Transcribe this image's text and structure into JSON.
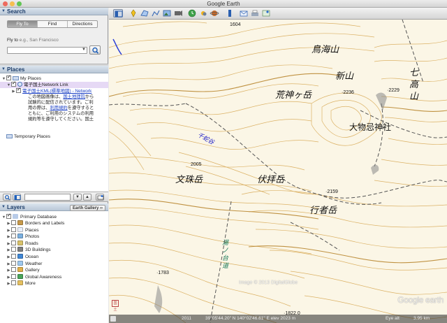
{
  "window": {
    "title": "Google Earth"
  },
  "search": {
    "header": "Search",
    "tabs": [
      {
        "label": "Fly To",
        "active": true
      },
      {
        "label": "Find Businesses",
        "active": false
      },
      {
        "label": "Directions",
        "active": false
      }
    ],
    "fly_to_label": "Fly to",
    "fly_to_example": "e.g., San Francisco",
    "input_value": ""
  },
  "places": {
    "header": "Places",
    "my_places": "My Places",
    "network_link": "電子国土Network Link",
    "kml_link_text": "電子国土KML(標準地図) - Network",
    "description": {
      "line1": "この地図画像は、",
      "link_gsi": "国土地理院",
      "line1b": "から",
      "line2": "試験的に配信されています。ご利",
      "line3": "用の際は、",
      "link_terms": "利用規約",
      "line3b": "を遵守すると",
      "line4": "ともに、ご利用のシステムの利用",
      "line5": "規約等を遵守してください。国土"
    },
    "temporary_places": "Temporary Places"
  },
  "layers": {
    "header": "Layers",
    "earth_gallery": "Earth Gallery ››",
    "primary_database": "Primary Database",
    "items": [
      {
        "label": "Borders and Labels",
        "icon": "borders-icon",
        "color": "#c79a4a"
      },
      {
        "label": "Places",
        "icon": "places-icon",
        "color": "#e8eef8"
      },
      {
        "label": "Photos",
        "icon": "photos-icon",
        "color": "#7bb0e0"
      },
      {
        "label": "Roads",
        "icon": "roads-icon",
        "color": "#d9c26a"
      },
      {
        "label": "3D Buildings",
        "icon": "buildings-icon",
        "color": "#7f7f7f"
      },
      {
        "label": "Ocean",
        "icon": "ocean-icon",
        "color": "#3f87d6"
      },
      {
        "label": "Weather",
        "icon": "weather-icon",
        "color": "#9ec9ef"
      },
      {
        "label": "Gallery",
        "icon": "gallery-icon",
        "color": "#e2b04a"
      },
      {
        "label": "Global Awareness",
        "icon": "global-awareness-icon",
        "color": "#4aa55a"
      },
      {
        "label": "More",
        "icon": "more-icon",
        "color": "#e5c060"
      }
    ]
  },
  "map": {
    "labels": {
      "chokai": "鳥海山",
      "shinzan": "新山",
      "shichikozan": "七高山",
      "arakamigatake": "荒神ヶ岳",
      "omonoimi": "大物忌神社",
      "senjadani": "千蛇谷",
      "monjudake": "文珠岳",
      "fukugamidake": "伏拝岳",
      "gyojadake": "行者岳",
      "yunodai": "湯ノ台道",
      "elev_2236": "·2236",
      "elev_2229": "·2229",
      "elev_2005": "2005",
      "elev_2159": "·2159",
      "elev_1783": "·1783",
      "elev_1604": "1604",
      "elev_1822": "·1822.0"
    },
    "copyright": "Image © 2013 DigitalGlobe",
    "logo": "Google earth",
    "stamp": "国土"
  },
  "status": {
    "year": "2011",
    "coords": "39°05'44.20\" N 140°02'46.61\" E elev 2023 m",
    "eye_alt": "Eye alt",
    "eye_alt_value": "3.95 km"
  }
}
